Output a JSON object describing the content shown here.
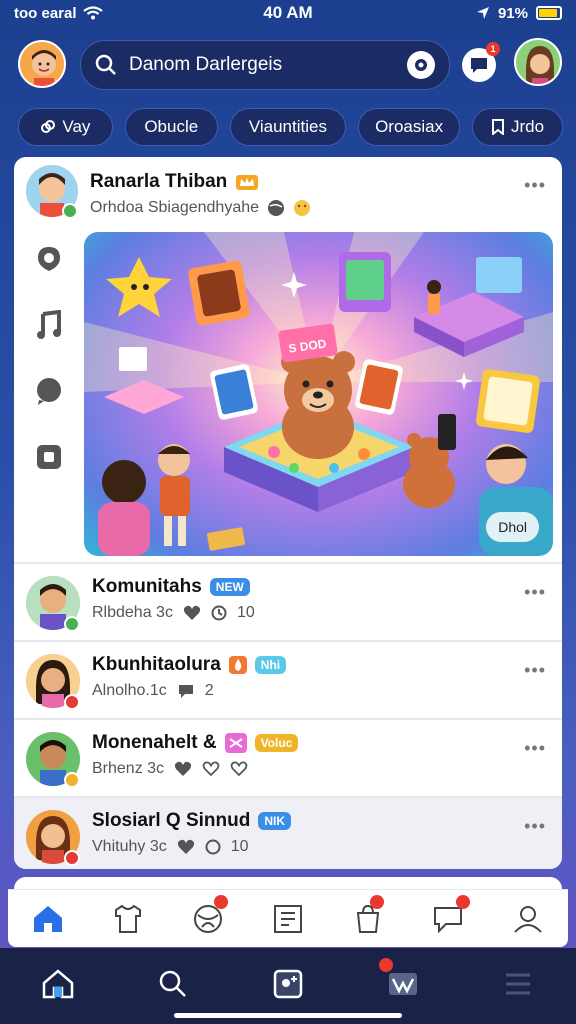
{
  "status_bar": {
    "carrier": "too earal",
    "time": "40 AM",
    "battery": "91%",
    "battery_level": 0.8,
    "wifi_icon": "wifi-icon",
    "location_icon": "location-icon"
  },
  "search": {
    "placeholder": "Danom Darlergeis"
  },
  "top_bar": {
    "notification_count": "1"
  },
  "chips": [
    {
      "label": "Vay",
      "icon": "link-icon"
    },
    {
      "label": "Obucle"
    },
    {
      "label": "Viauntities"
    },
    {
      "label": "Oroasiax"
    },
    {
      "label": "Jrdo",
      "icon": "bookmark-icon"
    }
  ],
  "post": {
    "author": "Ranarla Thiban",
    "subtitle": "Orhdoa Sbiagendhyahe",
    "hero_chip": "Dhol",
    "hero_sign": "S DOD"
  },
  "side_rail": [
    "pin-icon",
    "music-note-icon",
    "chat-bubble-icon",
    "square-icon"
  ],
  "rows": [
    {
      "name": "Komunitahs",
      "tag": "NEW",
      "tag_color": "#3a8ee6",
      "meta": "Rlbdeha 3c",
      "count": "10",
      "status_color": "#4caf50"
    },
    {
      "name": "Kbunhitaolura",
      "tag": "Nhi",
      "tag_color": "#5ac8e8",
      "meta": "Alnolho.1c",
      "count": "2",
      "status_color": "#e53935"
    },
    {
      "name": "Monenahelt &",
      "tag": "Voluc",
      "tag_color": "#f0b429",
      "meta": "Brhenz 3c",
      "count": "",
      "status_color": "#f0b429"
    },
    {
      "name": "Slosiarl Q Sinnud",
      "tag": "NIK",
      "tag_color": "#3a8ee6",
      "meta": "Vhituhy 3c",
      "count": "10",
      "status_color": "#e53935"
    }
  ],
  "colors": {
    "accent": "#2a6ee8",
    "background_top": "#1c3f8f",
    "background_bottom": "#6a4fc4",
    "nav_bar": "#1a2347",
    "badge": "#e8392c"
  }
}
